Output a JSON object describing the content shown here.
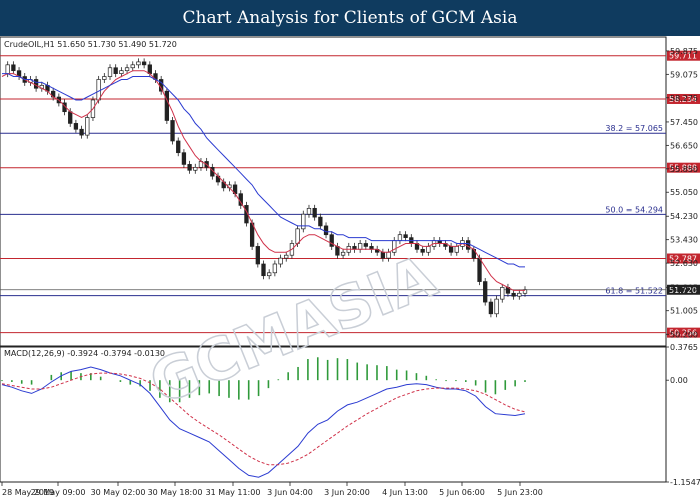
{
  "banner_title": "Chart Analysis for Clients of GCM Asia",
  "header": "CrudeOIL,H1  51.650 51.730 51.490 51.720",
  "macd_header": "MACD(12,26,9) -0.3924 -0.3794 -0.0130",
  "watermark": "GCMASIA",
  "chart_data": [
    {
      "type": "candlestick",
      "ylim": [
        49.8,
        60.35
      ],
      "y_ticks": [
        "59.875",
        "59.075",
        "58.275",
        "57.450",
        "56.650",
        "55.850",
        "55.050",
        "54.230",
        "53.430",
        "52.630",
        "51.805",
        "51.005",
        "50.200"
      ],
      "x_ticks": [
        "28 May 2019",
        "29 May 09:00",
        "30 May 02:00",
        "30 May 18:00",
        "31 May 11:00",
        "3 Jun 04:00",
        "3 Jun 20:00",
        "4 Jun 13:00",
        "5 Jun 06:00",
        "5 Jun 23:00"
      ],
      "price_levels": [
        {
          "label": "59.711",
          "value": 59.711,
          "color": "#c3262f"
        },
        {
          "label": "58.234",
          "value": 58.234,
          "color": "#c3262f"
        },
        {
          "label": "55.888",
          "value": 55.888,
          "color": "#c3262f"
        },
        {
          "label": "52.787",
          "value": 52.787,
          "color": "#c3262f"
        },
        {
          "label": "50.256",
          "value": 50.256,
          "color": "#c3262f"
        }
      ],
      "fib_levels": [
        {
          "label": "38.2 = 57.065",
          "value": 57.065
        },
        {
          "label": "50.0 = 54.294",
          "value": 54.294
        },
        {
          "label": "61.8 = 51.522",
          "value": 51.522
        }
      ],
      "current_price": {
        "label": "51.720",
        "value": 51.72
      },
      "close_path": [
        59.1,
        59.4,
        59.2,
        59.0,
        58.8,
        58.9,
        58.6,
        58.7,
        58.5,
        58.3,
        58.1,
        57.8,
        57.4,
        57.2,
        57.0,
        57.6,
        58.2,
        58.9,
        59.0,
        59.3,
        59.1,
        59.2,
        59.3,
        59.4,
        59.5,
        59.4,
        59.1,
        58.9,
        58.5,
        57.5,
        56.8,
        56.4,
        56.0,
        55.8,
        55.9,
        56.1,
        55.9,
        55.6,
        55.4,
        55.2,
        55.3,
        55.0,
        54.6,
        54.0,
        53.2,
        52.6,
        52.2,
        52.3,
        52.6,
        52.8,
        52.9,
        53.3,
        53.8,
        54.3,
        54.5,
        54.2,
        53.9,
        53.6,
        53.2,
        52.9,
        53.0,
        53.2,
        53.1,
        53.3,
        53.2,
        53.1,
        53.0,
        52.8,
        53.0,
        53.4,
        53.6,
        53.5,
        53.3,
        53.1,
        53.0,
        53.2,
        53.4,
        53.3,
        53.2,
        53.0,
        53.2,
        53.4,
        53.1,
        52.8,
        52.0,
        51.3,
        50.9,
        51.4,
        51.8,
        51.6,
        51.5,
        51.6,
        51.72
      ],
      "ma_fast_path": [
        59.0,
        59.1,
        59.1,
        59.0,
        58.9,
        58.8,
        58.7,
        58.6,
        58.5,
        58.3,
        58.2,
        58.0,
        57.8,
        57.7,
        57.6,
        57.7,
        57.9,
        58.2,
        58.5,
        58.7,
        58.9,
        59.0,
        59.1,
        59.2,
        59.2,
        59.2,
        59.1,
        58.9,
        58.6,
        58.2,
        57.8,
        57.3,
        56.9,
        56.6,
        56.3,
        56.1,
        56.0,
        55.8,
        55.6,
        55.4,
        55.2,
        55.0,
        54.7,
        54.4,
        54.0,
        53.6,
        53.3,
        53.1,
        53.0,
        53.0,
        53.0,
        53.1,
        53.3,
        53.5,
        53.6,
        53.6,
        53.5,
        53.4,
        53.3,
        53.2,
        53.1,
        53.1,
        53.1,
        53.1,
        53.1,
        53.1,
        53.1,
        53.0,
        53.0,
        53.1,
        53.2,
        53.3,
        53.3,
        53.3,
        53.2,
        53.2,
        53.3,
        53.3,
        53.3,
        53.2,
        53.2,
        53.3,
        53.2,
        53.1,
        52.8,
        52.5,
        52.2,
        52.0,
        51.9,
        51.8,
        51.7,
        51.7,
        51.7
      ],
      "ma_slow_path": [
        59.1,
        59.1,
        59.0,
        59.0,
        58.9,
        58.9,
        58.8,
        58.8,
        58.7,
        58.6,
        58.5,
        58.4,
        58.3,
        58.2,
        58.2,
        58.3,
        58.4,
        58.5,
        58.6,
        58.7,
        58.8,
        58.9,
        58.9,
        59.0,
        59.0,
        59.0,
        59.0,
        58.9,
        58.8,
        58.6,
        58.4,
        58.2,
        57.9,
        57.7,
        57.4,
        57.2,
        56.9,
        56.7,
        56.5,
        56.3,
        56.1,
        55.9,
        55.7,
        55.5,
        55.3,
        55.0,
        54.8,
        54.6,
        54.4,
        54.2,
        54.1,
        54.0,
        53.9,
        53.9,
        53.9,
        53.8,
        53.8,
        53.7,
        53.7,
        53.6,
        53.6,
        53.5,
        53.5,
        53.5,
        53.5,
        53.4,
        53.4,
        53.4,
        53.4,
        53.4,
        53.4,
        53.4,
        53.4,
        53.4,
        53.4,
        53.4,
        53.4,
        53.4,
        53.4,
        53.4,
        53.3,
        53.3,
        53.3,
        53.2,
        53.1,
        53.0,
        52.9,
        52.8,
        52.7,
        52.6,
        52.6,
        52.5,
        52.5
      ]
    },
    {
      "type": "macd",
      "ylim": [
        -1.1547,
        0.3765
      ],
      "y_ticks": [
        "0.3765",
        "0.00",
        "-1.1547"
      ],
      "macd_path": [
        -0.05,
        -0.08,
        -0.12,
        -0.15,
        -0.1,
        -0.02,
        0.05,
        0.1,
        0.12,
        0.15,
        0.12,
        0.08,
        0.05,
        0.0,
        -0.05,
        -0.15,
        -0.3,
        -0.45,
        -0.55,
        -0.6,
        -0.65,
        -0.7,
        -0.8,
        -0.9,
        -1.0,
        -1.08,
        -1.1,
        -1.05,
        -0.95,
        -0.85,
        -0.75,
        -0.6,
        -0.5,
        -0.45,
        -0.35,
        -0.28,
        -0.25,
        -0.2,
        -0.15,
        -0.1,
        -0.08,
        -0.05,
        -0.04,
        -0.05,
        -0.08,
        -0.1,
        -0.1,
        -0.12,
        -0.18,
        -0.3,
        -0.38,
        -0.39,
        -0.4,
        -0.38
      ],
      "signal_path": [
        -0.04,
        -0.06,
        -0.08,
        -0.1,
        -0.1,
        -0.08,
        -0.04,
        0.0,
        0.04,
        0.07,
        0.08,
        0.08,
        0.07,
        0.05,
        0.02,
        -0.03,
        -0.1,
        -0.2,
        -0.3,
        -0.4,
        -0.48,
        -0.55,
        -0.62,
        -0.7,
        -0.78,
        -0.86,
        -0.92,
        -0.96,
        -0.96,
        -0.94,
        -0.9,
        -0.84,
        -0.76,
        -0.68,
        -0.6,
        -0.52,
        -0.45,
        -0.38,
        -0.32,
        -0.26,
        -0.2,
        -0.16,
        -0.12,
        -0.1,
        -0.09,
        -0.09,
        -0.09,
        -0.1,
        -0.12,
        -0.16,
        -0.22,
        -0.28,
        -0.33,
        -0.36
      ],
      "histogram": [
        -0.01,
        -0.02,
        -0.04,
        -0.05,
        0.0,
        0.06,
        0.09,
        0.1,
        0.08,
        0.08,
        0.04,
        0.0,
        -0.02,
        -0.05,
        -0.07,
        -0.12,
        -0.2,
        -0.25,
        -0.25,
        -0.2,
        -0.17,
        -0.15,
        -0.18,
        -0.2,
        -0.22,
        -0.22,
        -0.18,
        -0.09,
        0.01,
        0.09,
        0.15,
        0.24,
        0.26,
        0.23,
        0.25,
        0.24,
        0.2,
        0.18,
        0.17,
        0.16,
        0.12,
        0.11,
        0.08,
        0.05,
        0.01,
        -0.01,
        -0.01,
        -0.02,
        -0.06,
        -0.14,
        -0.16,
        -0.11,
        -0.07,
        -0.02
      ]
    }
  ]
}
